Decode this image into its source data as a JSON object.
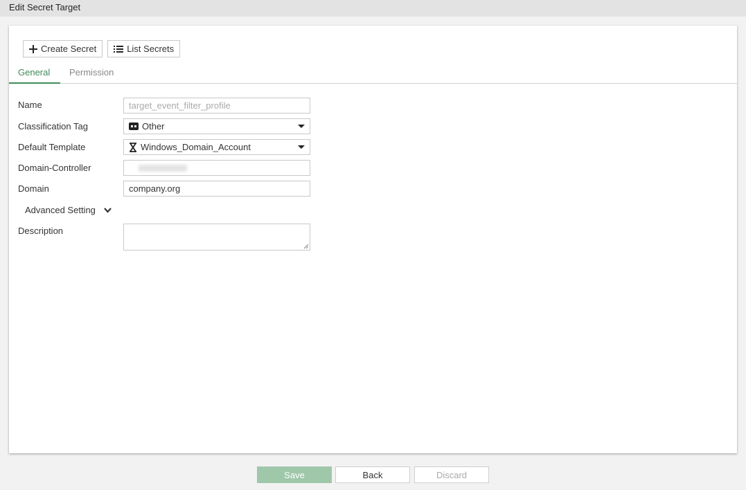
{
  "window": {
    "title": "Edit Secret Target"
  },
  "toolbar": {
    "create_label": "Create Secret",
    "list_label": "List Secrets"
  },
  "tabs": [
    {
      "label": "General",
      "active": true
    },
    {
      "label": "Permission",
      "active": false
    }
  ],
  "form": {
    "name": {
      "label": "Name",
      "value": "target_event_filter_profile"
    },
    "classification_tag": {
      "label": "Classification Tag",
      "value": "Other",
      "icon": "tag-icon"
    },
    "default_template": {
      "label": "Default Template",
      "value": "Windows_Domain_Account",
      "icon": "hourglass-icon"
    },
    "domain_controller": {
      "label": "Domain-Controller",
      "value": ""
    },
    "domain": {
      "label": "Domain",
      "value": "company.org"
    },
    "advanced_label": "Advanced Setting",
    "description": {
      "label": "Description",
      "value": ""
    }
  },
  "footer": {
    "save_label": "Save",
    "back_label": "Back",
    "discard_label": "Discard"
  },
  "colors": {
    "accent": "#3e8a57",
    "save_bg": "#9fc7aa"
  }
}
